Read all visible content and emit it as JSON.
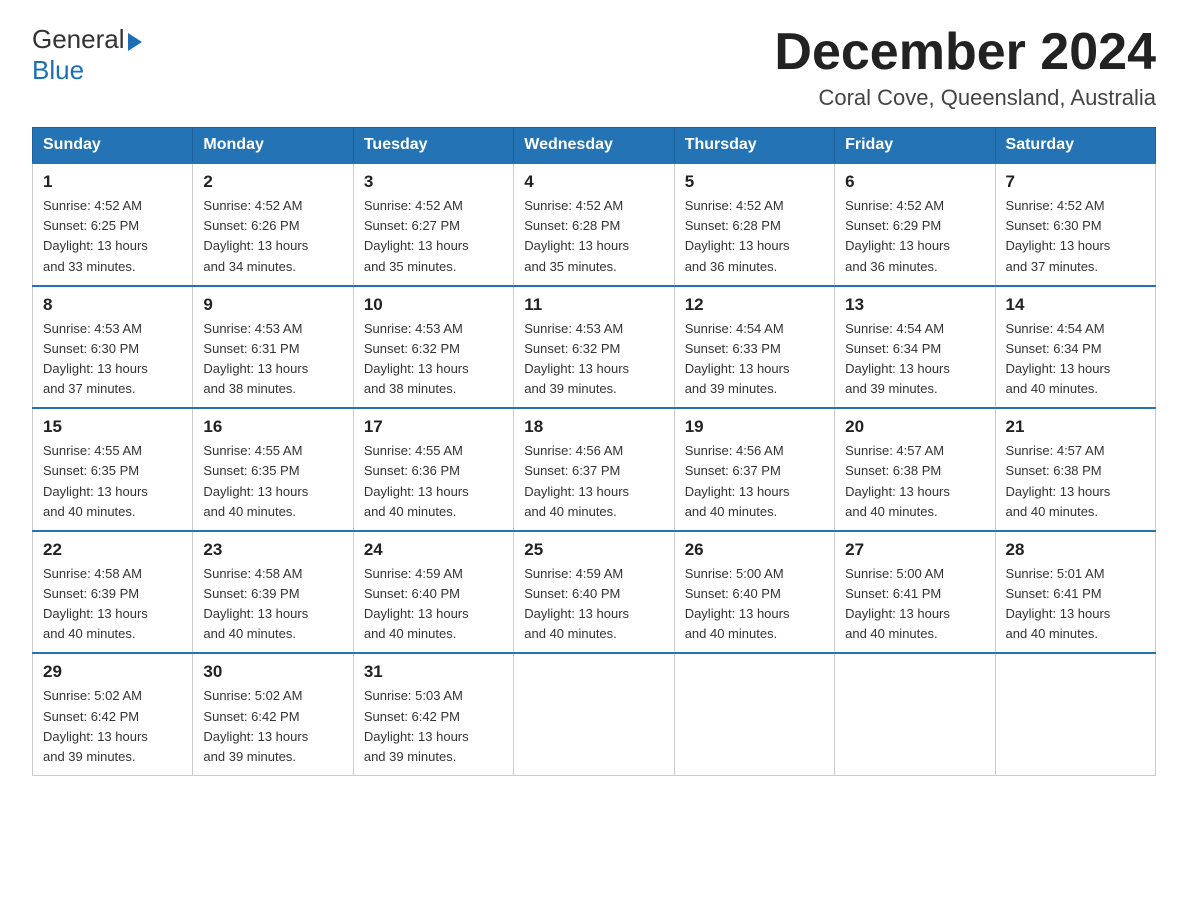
{
  "header": {
    "logo_general": "General",
    "logo_blue": "Blue",
    "month_title": "December 2024",
    "location": "Coral Cove, Queensland, Australia"
  },
  "days_of_week": [
    "Sunday",
    "Monday",
    "Tuesday",
    "Wednesday",
    "Thursday",
    "Friday",
    "Saturday"
  ],
  "weeks": [
    [
      {
        "day": "1",
        "sunrise": "4:52 AM",
        "sunset": "6:25 PM",
        "daylight": "13 hours and 33 minutes."
      },
      {
        "day": "2",
        "sunrise": "4:52 AM",
        "sunset": "6:26 PM",
        "daylight": "13 hours and 34 minutes."
      },
      {
        "day": "3",
        "sunrise": "4:52 AM",
        "sunset": "6:27 PM",
        "daylight": "13 hours and 35 minutes."
      },
      {
        "day": "4",
        "sunrise": "4:52 AM",
        "sunset": "6:28 PM",
        "daylight": "13 hours and 35 minutes."
      },
      {
        "day": "5",
        "sunrise": "4:52 AM",
        "sunset": "6:28 PM",
        "daylight": "13 hours and 36 minutes."
      },
      {
        "day": "6",
        "sunrise": "4:52 AM",
        "sunset": "6:29 PM",
        "daylight": "13 hours and 36 minutes."
      },
      {
        "day": "7",
        "sunrise": "4:52 AM",
        "sunset": "6:30 PM",
        "daylight": "13 hours and 37 minutes."
      }
    ],
    [
      {
        "day": "8",
        "sunrise": "4:53 AM",
        "sunset": "6:30 PM",
        "daylight": "13 hours and 37 minutes."
      },
      {
        "day": "9",
        "sunrise": "4:53 AM",
        "sunset": "6:31 PM",
        "daylight": "13 hours and 38 minutes."
      },
      {
        "day": "10",
        "sunrise": "4:53 AM",
        "sunset": "6:32 PM",
        "daylight": "13 hours and 38 minutes."
      },
      {
        "day": "11",
        "sunrise": "4:53 AM",
        "sunset": "6:32 PM",
        "daylight": "13 hours and 39 minutes."
      },
      {
        "day": "12",
        "sunrise": "4:54 AM",
        "sunset": "6:33 PM",
        "daylight": "13 hours and 39 minutes."
      },
      {
        "day": "13",
        "sunrise": "4:54 AM",
        "sunset": "6:34 PM",
        "daylight": "13 hours and 39 minutes."
      },
      {
        "day": "14",
        "sunrise": "4:54 AM",
        "sunset": "6:34 PM",
        "daylight": "13 hours and 40 minutes."
      }
    ],
    [
      {
        "day": "15",
        "sunrise": "4:55 AM",
        "sunset": "6:35 PM",
        "daylight": "13 hours and 40 minutes."
      },
      {
        "day": "16",
        "sunrise": "4:55 AM",
        "sunset": "6:35 PM",
        "daylight": "13 hours and 40 minutes."
      },
      {
        "day": "17",
        "sunrise": "4:55 AM",
        "sunset": "6:36 PM",
        "daylight": "13 hours and 40 minutes."
      },
      {
        "day": "18",
        "sunrise": "4:56 AM",
        "sunset": "6:37 PM",
        "daylight": "13 hours and 40 minutes."
      },
      {
        "day": "19",
        "sunrise": "4:56 AM",
        "sunset": "6:37 PM",
        "daylight": "13 hours and 40 minutes."
      },
      {
        "day": "20",
        "sunrise": "4:57 AM",
        "sunset": "6:38 PM",
        "daylight": "13 hours and 40 minutes."
      },
      {
        "day": "21",
        "sunrise": "4:57 AM",
        "sunset": "6:38 PM",
        "daylight": "13 hours and 40 minutes."
      }
    ],
    [
      {
        "day": "22",
        "sunrise": "4:58 AM",
        "sunset": "6:39 PM",
        "daylight": "13 hours and 40 minutes."
      },
      {
        "day": "23",
        "sunrise": "4:58 AM",
        "sunset": "6:39 PM",
        "daylight": "13 hours and 40 minutes."
      },
      {
        "day": "24",
        "sunrise": "4:59 AM",
        "sunset": "6:40 PM",
        "daylight": "13 hours and 40 minutes."
      },
      {
        "day": "25",
        "sunrise": "4:59 AM",
        "sunset": "6:40 PM",
        "daylight": "13 hours and 40 minutes."
      },
      {
        "day": "26",
        "sunrise": "5:00 AM",
        "sunset": "6:40 PM",
        "daylight": "13 hours and 40 minutes."
      },
      {
        "day": "27",
        "sunrise": "5:00 AM",
        "sunset": "6:41 PM",
        "daylight": "13 hours and 40 minutes."
      },
      {
        "day": "28",
        "sunrise": "5:01 AM",
        "sunset": "6:41 PM",
        "daylight": "13 hours and 40 minutes."
      }
    ],
    [
      {
        "day": "29",
        "sunrise": "5:02 AM",
        "sunset": "6:42 PM",
        "daylight": "13 hours and 39 minutes."
      },
      {
        "day": "30",
        "sunrise": "5:02 AM",
        "sunset": "6:42 PM",
        "daylight": "13 hours and 39 minutes."
      },
      {
        "day": "31",
        "sunrise": "5:03 AM",
        "sunset": "6:42 PM",
        "daylight": "13 hours and 39 minutes."
      },
      null,
      null,
      null,
      null
    ]
  ],
  "labels": {
    "sunrise": "Sunrise:",
    "sunset": "Sunset:",
    "daylight": "Daylight:"
  }
}
